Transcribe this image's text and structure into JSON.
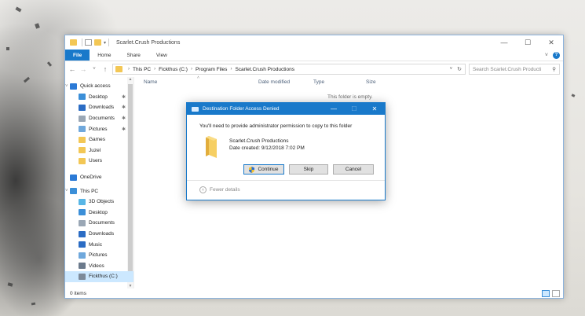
{
  "window": {
    "title": "Scarlet.Crush Productions",
    "controls": {
      "minimize": "—",
      "maximize": "☐",
      "close": "✕"
    }
  },
  "ribbon": {
    "tabs": [
      "File",
      "Home",
      "Share",
      "View"
    ],
    "expand_icon": "chevron-down-icon",
    "help_label": "?"
  },
  "address": {
    "crumbs": [
      "This PC",
      "Fickthus (C:)",
      "Program Files",
      "Scarlet.Crush Productions"
    ],
    "search_placeholder": "Search Scarlet.Crush Producti"
  },
  "nav": {
    "items": [
      {
        "label": "Quick access",
        "level": 1,
        "icon": "star-icon",
        "color": "#2b7ad6",
        "chevron": "˅"
      },
      {
        "label": "Desktop",
        "level": 2,
        "icon": "desktop-icon",
        "color": "#3b8fd8",
        "pinned": true
      },
      {
        "label": "Downloads",
        "level": 2,
        "icon": "download-icon",
        "color": "#2b6cc4",
        "pinned": true
      },
      {
        "label": "Documents",
        "level": 2,
        "icon": "documents-icon",
        "color": "#9aa7b5",
        "pinned": true
      },
      {
        "label": "Pictures",
        "level": 2,
        "icon": "pictures-icon",
        "color": "#6fa8dc",
        "pinned": true
      },
      {
        "label": "Games",
        "level": 2,
        "icon": "folder-icon",
        "color": "#f3c755"
      },
      {
        "label": "Juzel",
        "level": 2,
        "icon": "folder-icon",
        "color": "#f3c755"
      },
      {
        "label": "Users",
        "level": 2,
        "icon": "folder-icon",
        "color": "#f3c755"
      },
      {
        "label": "OneDrive",
        "level": 1,
        "icon": "cloud-icon",
        "color": "#2b7ad6"
      },
      {
        "label": "This PC",
        "level": 1,
        "icon": "computer-icon",
        "color": "#3b8fd8",
        "chevron": "˅"
      },
      {
        "label": "3D Objects",
        "level": 2,
        "icon": "cube-icon",
        "color": "#58b6e6"
      },
      {
        "label": "Desktop",
        "level": 2,
        "icon": "desktop-icon",
        "color": "#3b8fd8"
      },
      {
        "label": "Documents",
        "level": 2,
        "icon": "documents-icon",
        "color": "#9aa7b5"
      },
      {
        "label": "Downloads",
        "level": 2,
        "icon": "download-icon",
        "color": "#2b6cc4"
      },
      {
        "label": "Music",
        "level": 2,
        "icon": "music-icon",
        "color": "#2b6cc4"
      },
      {
        "label": "Pictures",
        "level": 2,
        "icon": "pictures-icon",
        "color": "#6fa8dc"
      },
      {
        "label": "Videos",
        "level": 2,
        "icon": "video-icon",
        "color": "#6b7a8c"
      },
      {
        "label": "Fickthus (C:)",
        "level": 2,
        "icon": "drive-icon",
        "color": "#7d8a99",
        "selected": true
      }
    ],
    "pin_glyph": "📌"
  },
  "files": {
    "columns": [
      "Name",
      "Date modified",
      "Type",
      "Size"
    ],
    "empty_message": "This folder is empty."
  },
  "status": {
    "item_count": "0 items"
  },
  "dialog": {
    "title": "Destination Folder Access Denied",
    "message": "You'll need to provide administrator permission to copy to this folder",
    "folder_name": "Scarlet.Crush Productions",
    "date_created": "Date created: 9/12/2018 7:02 PM",
    "buttons": {
      "continue": "Continue",
      "skip": "Skip",
      "cancel": "Cancel"
    },
    "fewer_details": "Fewer details",
    "controls": {
      "minimize": "—",
      "maximize": "☐",
      "close": "✕"
    }
  }
}
